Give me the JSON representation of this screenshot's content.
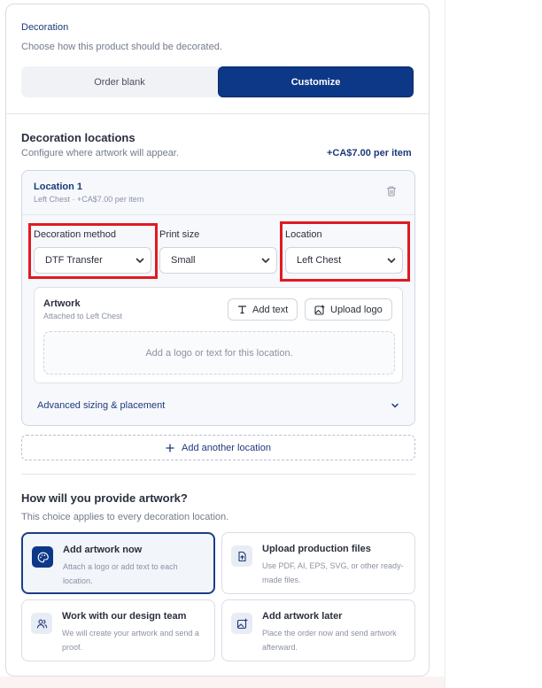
{
  "decoration": {
    "title": "Decoration",
    "subtitle": "Choose how this product should be decorated.",
    "options": {
      "blank": "Order blank",
      "customize": "Customize"
    },
    "selected": "Customize"
  },
  "locations_section": {
    "title": "Decoration locations",
    "subtitle": "Configure where artwork will appear.",
    "price": "+CA$7.00 per item"
  },
  "location_card": {
    "title": "Location 1",
    "subtitle": "Left Chest · +CA$7.00 per item",
    "method_label": "Decoration method",
    "method_value": "DTF Transfer",
    "size_label": "Print size",
    "size_value": "Small",
    "location_label": "Location",
    "location_value": "Left Chest"
  },
  "artwork": {
    "title": "Artwork",
    "subtitle": "Attached to Left Chest",
    "add_text": "Add text",
    "upload_logo": "Upload logo",
    "dropzone": "Add a logo or text for this location."
  },
  "advanced": "Advanced sizing & placement",
  "add_location": "Add another location",
  "provide": {
    "title": "How will you provide artwork?",
    "subtitle": "This choice applies to every decoration location.",
    "options": [
      {
        "title": "Add artwork now",
        "desc": "Attach a logo or add text to each location.",
        "icon": "palette-icon",
        "selected": true
      },
      {
        "title": "Upload production files",
        "desc": "Use PDF, AI, EPS, SVG, or other ready-made files.",
        "icon": "file-upload-icon",
        "selected": false
      },
      {
        "title": "Work with our design team",
        "desc": "We will create your artwork and send a proof.",
        "icon": "users-icon",
        "selected": false
      },
      {
        "title": "Add artwork later",
        "desc": "Place the order now and send artwork afterward.",
        "icon": "image-plus-icon",
        "selected": false
      }
    ]
  },
  "colors": {
    "accent": "#0d3888",
    "highlight_box": "#e01a22"
  }
}
